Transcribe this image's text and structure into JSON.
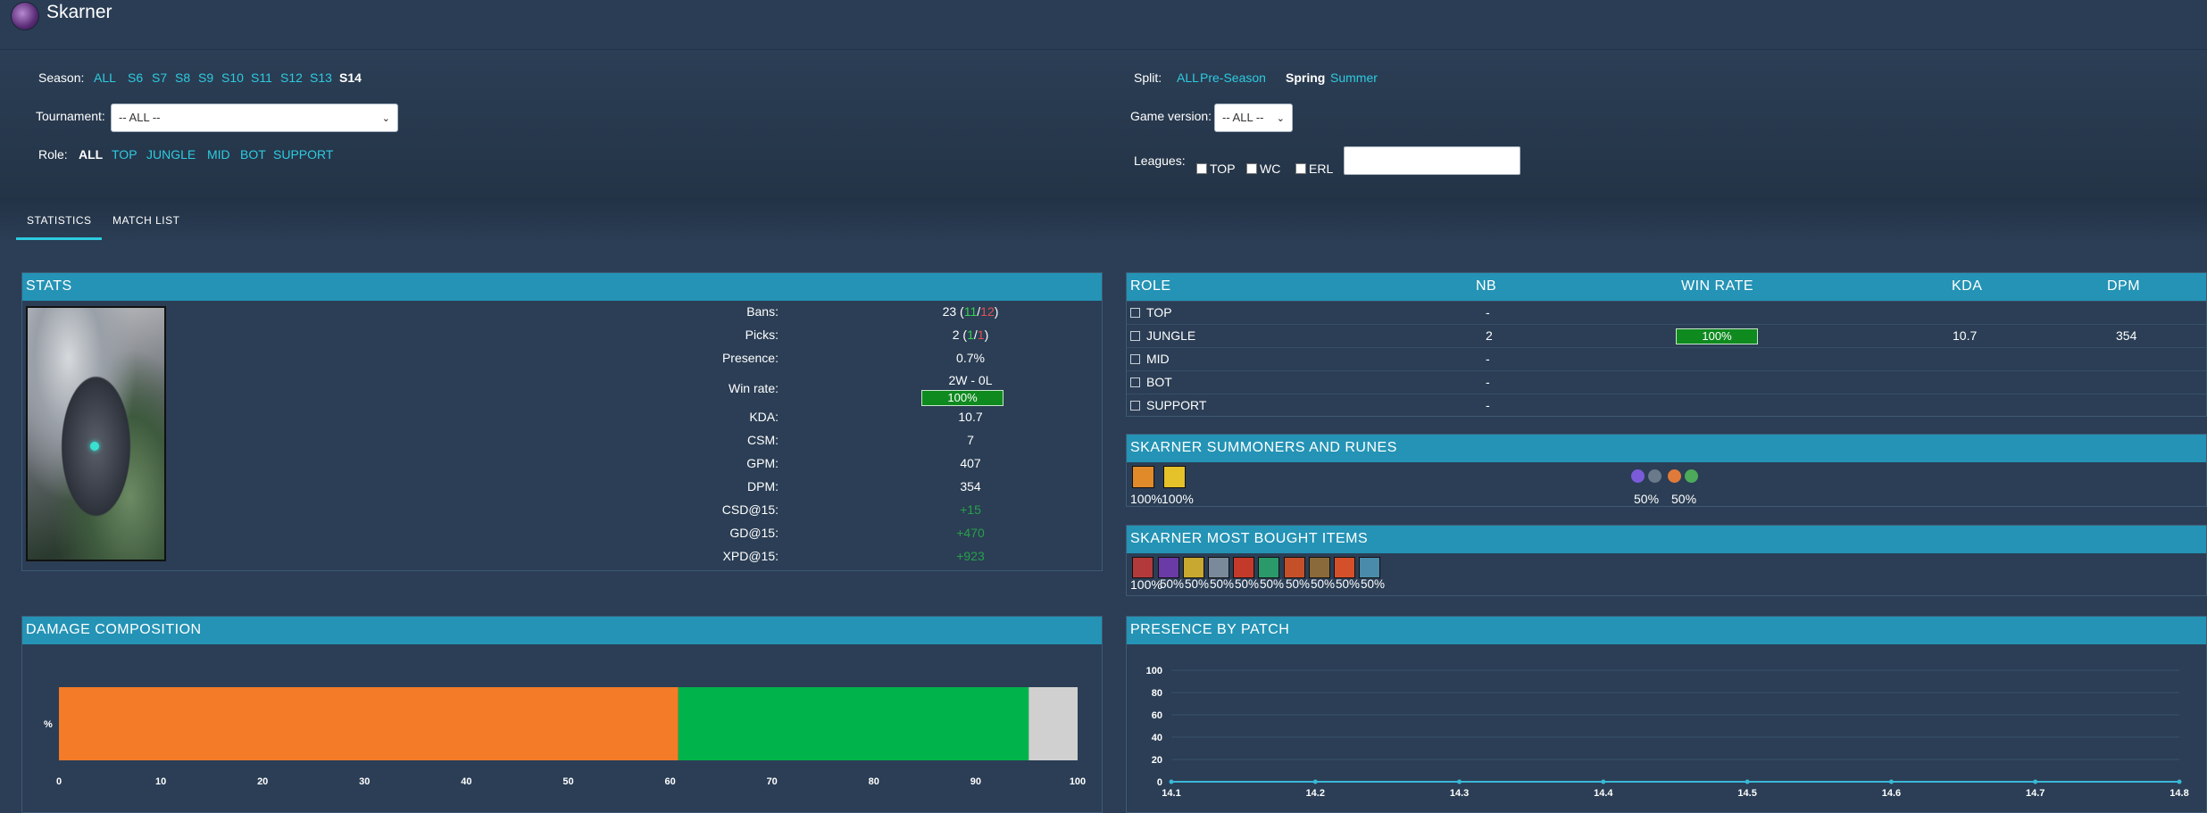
{
  "app": {
    "title": "Skarner"
  },
  "filters": {
    "season": {
      "label": "Season:",
      "options": [
        "ALL",
        "S6",
        "S7",
        "S8",
        "S9",
        "S10",
        "S11",
        "S12",
        "S13",
        "S14"
      ],
      "selected": "S14"
    },
    "split": {
      "label": "Split:",
      "options": [
        "ALL",
        "Pre-Season",
        "Spring",
        "Summer"
      ],
      "selected": "Spring"
    },
    "tournament": {
      "label": "Tournament:",
      "value": "-- ALL --"
    },
    "game_version": {
      "label": "Game version:",
      "value": "-- ALL --"
    },
    "role": {
      "label": "Role:",
      "options": [
        "ALL",
        "TOP",
        "JUNGLE",
        "MID",
        "BOT",
        "SUPPORT"
      ],
      "selected": "ALL"
    },
    "leagues": {
      "label": "Leagues:",
      "checkboxes": [
        "TOP",
        "WC",
        "ERL"
      ],
      "search_value": ""
    }
  },
  "tabs": [
    {
      "label": "STATISTICS",
      "active": true
    },
    {
      "label": "MATCH LIST",
      "active": false
    }
  ],
  "stats": {
    "title": "STATS",
    "bans": {
      "label": "Bans:",
      "total": "23",
      "blue": "11",
      "red": "12"
    },
    "picks": {
      "label": "Picks:",
      "total": "2",
      "blue": "1",
      "red": "1"
    },
    "presence": {
      "label": "Presence:",
      "value": "0.7%"
    },
    "win_rate": {
      "label": "Win rate:",
      "record": "2W - 0L",
      "value": "100%",
      "fraction": 1.0
    },
    "rows": [
      {
        "label": "KDA:",
        "value": "10.7",
        "positive": false
      },
      {
        "label": "CSM:",
        "value": "7",
        "positive": false
      },
      {
        "label": "GPM:",
        "value": "407",
        "positive": false
      },
      {
        "label": "DPM:",
        "value": "354",
        "positive": false
      },
      {
        "label": "CSD@15:",
        "value": "+15",
        "positive": true
      },
      {
        "label": "GD@15:",
        "value": "+470",
        "positive": true
      },
      {
        "label": "XPD@15:",
        "value": "+923",
        "positive": true
      }
    ]
  },
  "roles": {
    "headers": {
      "role": "ROLE",
      "nb": "NB",
      "win_rate": "WIN RATE",
      "kda": "KDA",
      "dpm": "DPM"
    },
    "rows": [
      {
        "role": "TOP",
        "nb": "-",
        "win_rate": "",
        "kda": "",
        "dpm": ""
      },
      {
        "role": "JUNGLE",
        "nb": "2",
        "win_rate": "100%",
        "kda": "10.7",
        "dpm": "354"
      },
      {
        "role": "MID",
        "nb": "-",
        "win_rate": "",
        "kda": "",
        "dpm": ""
      },
      {
        "role": "BOT",
        "nb": "-",
        "win_rate": "",
        "kda": "",
        "dpm": ""
      },
      {
        "role": "SUPPORT",
        "nb": "-",
        "win_rate": "",
        "kda": "",
        "dpm": ""
      }
    ]
  },
  "summoners": {
    "title": "SKARNER SUMMONERS AND RUNES",
    "spells": [
      {
        "icon": "flash-spell-icon",
        "color": "#e08a2a",
        "pct": "100%"
      },
      {
        "icon": "smite-spell-icon",
        "color": "#e6c22a",
        "pct": "100%"
      }
    ],
    "rune_sets": [
      {
        "icons": [
          "#7b5bd9",
          "#6a7a8a"
        ],
        "pct": "50%"
      },
      {
        "icons": [
          "#e07a3a",
          "#4caa5a"
        ],
        "pct": "50%"
      }
    ]
  },
  "items": {
    "title": "SKARNER MOST BOUGHT ITEMS",
    "list": [
      {
        "color": "#b33a3a",
        "pct": "100%"
      },
      {
        "color": "#6a3aa6",
        "pct": "50%"
      },
      {
        "color": "#c8a830",
        "pct": "50%"
      },
      {
        "color": "#7a8a9a",
        "pct": "50%"
      },
      {
        "color": "#c43a2a",
        "pct": "50%"
      },
      {
        "color": "#2a9a6a",
        "pct": "50%"
      },
      {
        "color": "#c4502a",
        "pct": "50%"
      },
      {
        "color": "#8a6a3a",
        "pct": "50%"
      },
      {
        "color": "#d4502a",
        "pct": "50%"
      },
      {
        "color": "#4a8aaa",
        "pct": "50%"
      }
    ]
  },
  "damage": {
    "title": "DAMAGE COMPOSITION",
    "chart_data": {
      "type": "bar",
      "orientation": "horizontal-stacked",
      "ylabel": "%",
      "xlim": [
        0,
        100
      ],
      "ticks": [
        "0",
        "10",
        "20",
        "30",
        "40",
        "50",
        "60",
        "70",
        "80",
        "90",
        "100"
      ],
      "segments": [
        {
          "value": 60.8,
          "color": "#f47b28"
        },
        {
          "value": 34.4,
          "color": "#00b34a"
        },
        {
          "value": 4.8,
          "color": "#d0d0d0"
        }
      ]
    }
  },
  "presence_chart": {
    "title": "PRESENCE BY PATCH",
    "chart_data": {
      "type": "line",
      "x": [
        "14.1",
        "14.2",
        "14.3",
        "14.4",
        "14.5",
        "14.6",
        "14.7",
        "14.8"
      ],
      "yticks": [
        "0",
        "20",
        "40",
        "60",
        "80",
        "100"
      ],
      "ylim": [
        0,
        100
      ],
      "series": [
        {
          "values": [
            0,
            0,
            0,
            0,
            0,
            0,
            0,
            0
          ],
          "color": "#3ab8d8"
        }
      ]
    }
  }
}
